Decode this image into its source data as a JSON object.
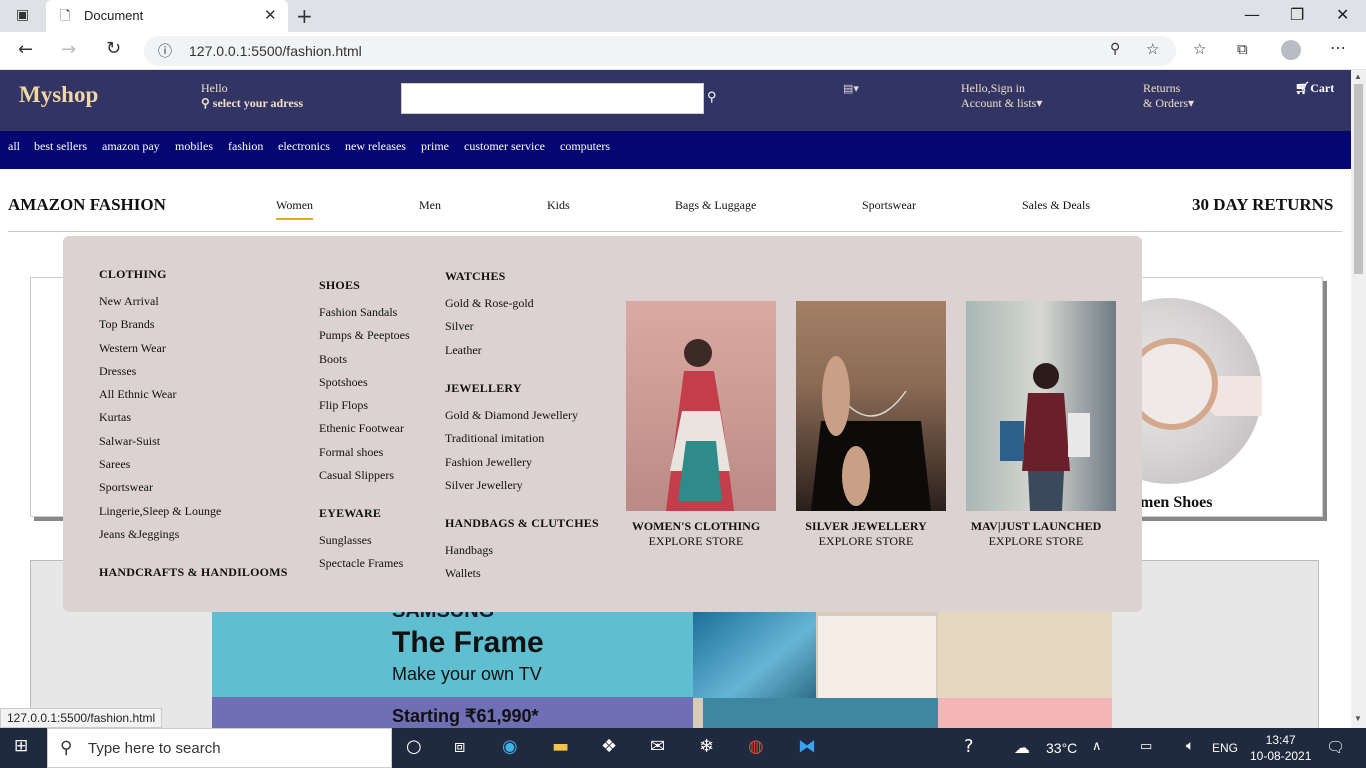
{
  "browser": {
    "tab_title": "Document",
    "url": "127.0.0.1:5500/fashion.html",
    "status_url": "127.0.0.1:5500/fashion.html"
  },
  "header": {
    "logo": "Myshop",
    "hello": "Hello",
    "address": "select your adress",
    "signin_line1": "Hello,Sign in",
    "signin_line2": "Account & lists",
    "returns_line1": "Returns",
    "returns_line2": "& Orders",
    "cart": "Cart",
    "search_value": ""
  },
  "catnav": [
    "all",
    "best sellers",
    "amazon pay",
    "mobiles",
    "fashion",
    "electronics",
    "new releases",
    "prime",
    "customer service",
    "computers"
  ],
  "fashion_nav": {
    "title": "AMAZON FASHION",
    "items": [
      "Women",
      "Men",
      "Kids",
      "Bags & Luggage",
      "Sportswear",
      "Sales & Deals"
    ],
    "active": "Women",
    "right": "30 DAY RETURNS"
  },
  "mega_menu": {
    "clothing": {
      "heading": "CLOTHING",
      "items": [
        "New Arrival",
        "Top Brands",
        "Western Wear",
        "Dresses",
        "All Ethnic Wear",
        "Kurtas",
        "Salwar-Suist",
        "Sarees",
        "Sportswear",
        "Lingerie,Sleep & Lounge",
        "Jeans &Jeggings"
      ]
    },
    "handcrafts": {
      "heading": "HANDCRAFTS & HANDILOOMS"
    },
    "shoes": {
      "heading": "SHOES",
      "items": [
        "Fashion Sandals",
        "Pumps & Peeptoes",
        "Boots",
        "Spotshoes",
        "Flip Flops",
        "Ethenic Footwear",
        "Formal shoes",
        "Casual Slippers"
      ]
    },
    "eyeware": {
      "heading": "EYEWARE",
      "items": [
        "Sunglasses",
        "Spectacle Frames"
      ]
    },
    "watches": {
      "heading": "WATCHES",
      "items": [
        "Gold & Rose-gold",
        "Silver",
        "Leather"
      ]
    },
    "jewellery": {
      "heading": "JEWELLERY",
      "items": [
        "Gold & Diamond Jewellery",
        "Traditional imitation",
        "Fashion Jewellery",
        "Silver Jewellery"
      ]
    },
    "handbags": {
      "heading": "HANDBAGS & CLUTCHES",
      "items": [
        "Handbags",
        "Wallets"
      ]
    },
    "promos": [
      {
        "title": "WOMEN'S CLOTHING",
        "cta": "EXPLORE STORE"
      },
      {
        "title": "SILVER JEWELLERY",
        "cta": "EXPLORE STORE"
      },
      {
        "title": "MAV|JUST LAUNCHED",
        "cta": "EXPLORE STORE"
      }
    ]
  },
  "background": {
    "shoes_label": "men Shoes",
    "banner_brand": "SAMSUNG",
    "banner_headline": "The Frame",
    "banner_sub": "Make your own TV",
    "banner_price": "Starting ₹61,990*"
  },
  "taskbar": {
    "search_placeholder": "Type here to search",
    "weather": "33°C",
    "lang": "ENG",
    "time": "13:47",
    "date": "10-08-2021"
  },
  "colors": {
    "header_bg": "#323464",
    "catnav_bg": "#060673",
    "mega_bg": "#dcd2d2",
    "active_underline": "#e5a823"
  }
}
